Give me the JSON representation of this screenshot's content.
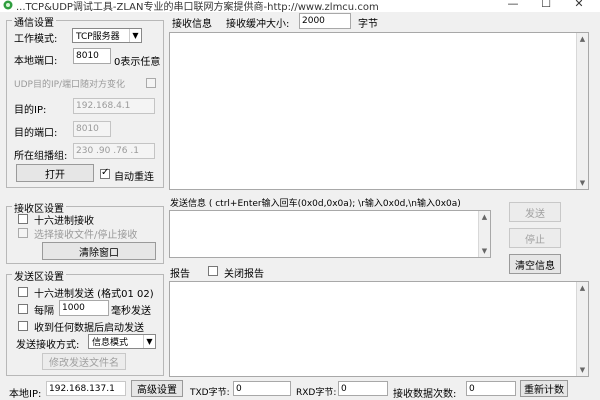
{
  "window": {
    "title": "...TCP&UDP调试工具-ZLAN专业的串口联网方案提供商-http://www.zlmcu.com",
    "minimize": "—",
    "maximize": "☐",
    "close": "✕"
  },
  "comm": {
    "title": "通信设置",
    "mode_label": "工作模式:",
    "mode_value": "TCP服务器",
    "local_port_label": "本地端口:",
    "local_port_value": "8010",
    "any_note": "0表示任意",
    "udp_change_label": "UDP目的IP/端口随对方变化",
    "dest_ip_label": "目的IP:",
    "dest_ip_value": "192.168.4.1",
    "dest_port_label": "目的端口:",
    "dest_port_value": "8010",
    "multicast_label": "所在组播组:",
    "multicast_value": "230 .90 .76 .1",
    "open_button": "打开",
    "auto_reconnect_label": "自动重连"
  },
  "recv": {
    "title": "接收区设置",
    "hex_label": "十六进制接收",
    "file_label": "选择接收文件/停止接收",
    "clear_button": "清除窗口"
  },
  "send": {
    "title": "发送区设置",
    "hex_label": "十六进制发送 (格式01 02)",
    "every_label": "每隔",
    "every_value": "1000",
    "ms_label": "毫秒发送",
    "auto_after_recv_label": "收到任何数据后启动发送",
    "method_label": "发送接收方式:",
    "method_value": "信息模式",
    "rename_button": "修改发送文件名"
  },
  "info": {
    "recv_label": "接收信息",
    "buffer_label": "接收缓冲大小:",
    "buffer_value": "2000",
    "byte_unit": "字节",
    "send_info_label": "发送信息 ( ctrl+Enter输入回车(0x0d,0x0a); \\r输入0x0d,\\n输入0x0a)",
    "send_button": "发送",
    "stop_button": "停止",
    "clear_info_button": "清空信息",
    "report_label": "报告",
    "close_report_label": "关闭报告"
  },
  "status": {
    "local_ip_label": "本地IP:",
    "local_ip_value": "192.168.137.1",
    "advanced_button": "高级设置",
    "txd_label": "TXD字节:",
    "txd_value": "0",
    "rxd_label": "RXD字节:",
    "rxd_value": "0",
    "recv_count_label": "接收数据次数:",
    "recv_count_value": "0",
    "reset_button": "重新计数"
  }
}
